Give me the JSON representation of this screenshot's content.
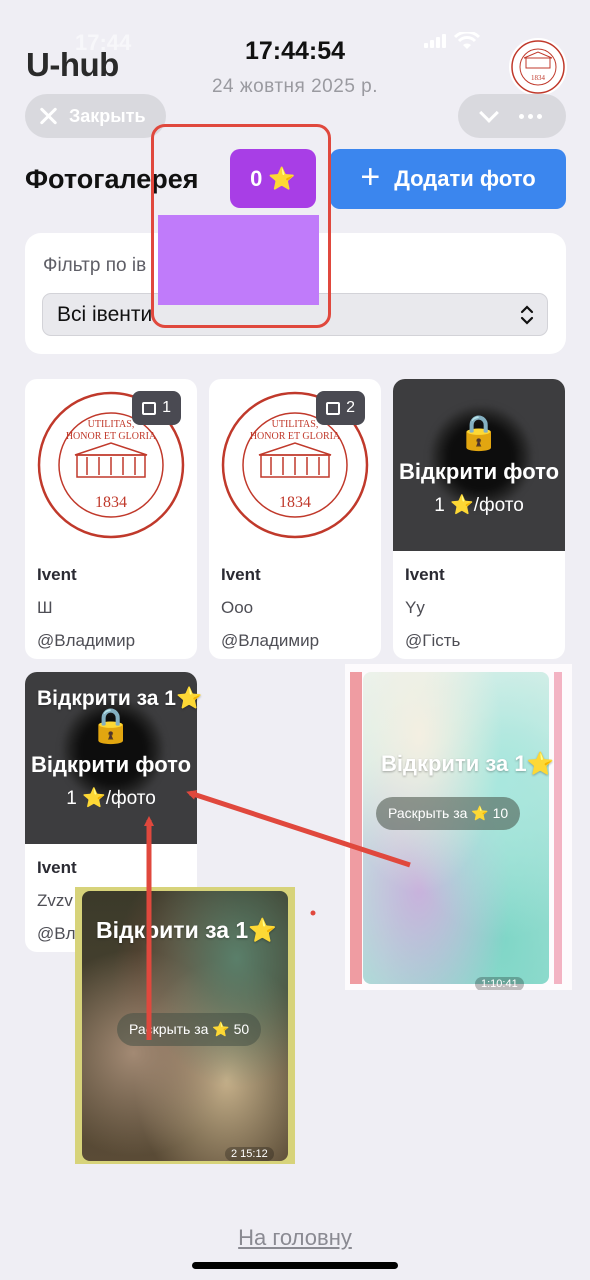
{
  "status_bar": {
    "time": "17:44"
  },
  "header": {
    "app_title": "U-hub",
    "clock": "17:44:54",
    "date": "24 жовтня 2025 р.",
    "seal_year": "1834",
    "close_label": "Закрыть"
  },
  "gallery": {
    "title": "Фотогалерея",
    "stars_count": "0",
    "star_glyph": "⭐",
    "add_label": "Додати фото"
  },
  "filter": {
    "label": "Фільтр по ів",
    "selected": "Всі івенти"
  },
  "cards": [
    {
      "count": "1",
      "event": "Ivent",
      "desc": "Ш",
      "author": "@Владимир",
      "seal_motto1": "UTILITAS,",
      "seal_motto2": "HONOR ET GLORIA",
      "seal_year": "1834"
    },
    {
      "count": "2",
      "event": "Ivent",
      "desc": "Ооо",
      "author": "@Владимир",
      "seal_motto1": "UTILITAS,",
      "seal_motto2": "HONOR ET GLORIA",
      "seal_year": "1834"
    },
    {
      "event": "Ivent",
      "desc": "Yy",
      "author": "@Гість",
      "open_label": "Відкрити фото",
      "price": "1 ⭐/фото"
    },
    {
      "event": "Ivent",
      "desc": "Zvzv",
      "author": "@Вл",
      "open_label": "Відкрити фото",
      "price": "1 ⭐/фото",
      "overlay": "Відкрити за 1⭐"
    }
  ],
  "annotations": {
    "right_overlay": "Відкрити за 1⭐",
    "right_pill": "Раскрыть за ⭐ 10",
    "right_time": "1:10:41",
    "left_overlay": "Відкрити за 1⭐",
    "left_pill": "Раскрыть за ⭐ 50",
    "left_time": "2 15:12"
  },
  "footer": {
    "home_label": "На головну"
  },
  "colors": {
    "background": "#efeef4",
    "stars_button": "#a83ee6",
    "add_button": "#3b86ee",
    "annotation_red": "#e0483d",
    "seal_red": "#c0392b",
    "redaction_purple": "#c07bfa"
  }
}
